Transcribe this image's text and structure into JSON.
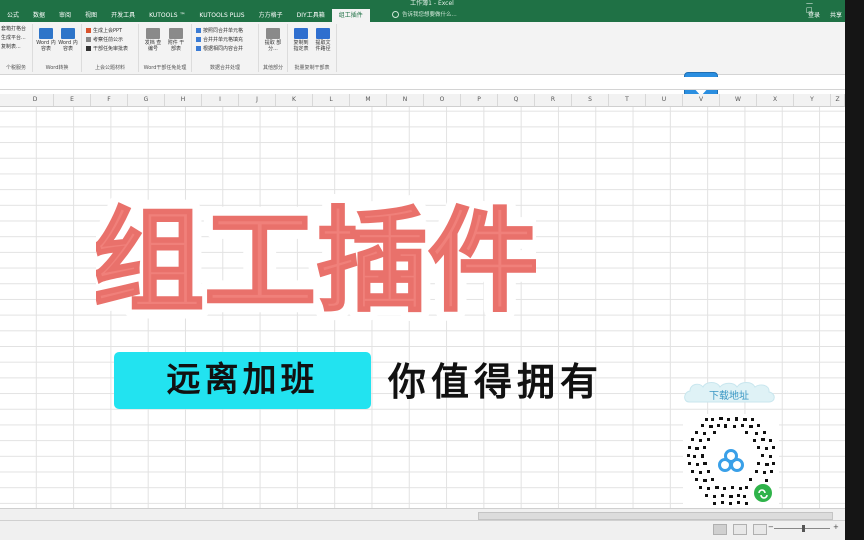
{
  "window": {
    "title": "工作簿1 - Excel"
  },
  "ribbon": {
    "tabs": [
      "公式",
      "数据",
      "审阅",
      "视图",
      "开发工具",
      "KUTOOLS ™",
      "KUTOOLS PLUS",
      "方方格子",
      "DIY工具箱",
      "组工插件"
    ],
    "active_tab": "组工插件",
    "tell_me": "告诉我您想要做什么...",
    "sign_in": "登录",
    "share": "共享"
  },
  "ribbon_groups": [
    {
      "label": "个税服务",
      "items": [
        "套箱打格台",
        "生成平台...",
        "复制表..."
      ]
    },
    {
      "label": "Word转换",
      "items": [
        "Word 内容表",
        "Word 内容表"
      ]
    },
    {
      "label": "上会公题材料",
      "items": [
        "生成上会PPT",
        "考察任前公示",
        "干部任免审批表"
      ]
    },
    {
      "label": "Word干部任免处理",
      "items": [
        "发档 查编号",
        "附件 干部表"
      ]
    },
    {
      "label": "数据合并处理",
      "items": [
        "按照同合并单元格",
        "合并并单元格填充",
        "根据相同内容合并"
      ]
    },
    {
      "label": "其他部分",
      "items": [
        "提取 部分..."
      ]
    },
    {
      "label": "批量复制干部表",
      "items": [
        "复制到 指定表",
        "提取文 件路径"
      ]
    }
  ],
  "columns": [
    "D",
    "E",
    "F",
    "G",
    "H",
    "I",
    "J",
    "K",
    "L",
    "M",
    "N",
    "O",
    "P",
    "Q",
    "R",
    "S",
    "T",
    "U",
    "V",
    "W",
    "X",
    "Y",
    "Z"
  ],
  "banner": {
    "title": "组工插件",
    "subtitle": "远离加班",
    "tagline": "你值得拥有",
    "title_color": "#f0807a",
    "pill_color": "#22e3f0"
  },
  "download": {
    "label": "下载地址"
  },
  "icons": [
    "download-arrow-icon",
    "search-icon",
    "qr-code",
    "minus-icon",
    "plus-icon"
  ]
}
